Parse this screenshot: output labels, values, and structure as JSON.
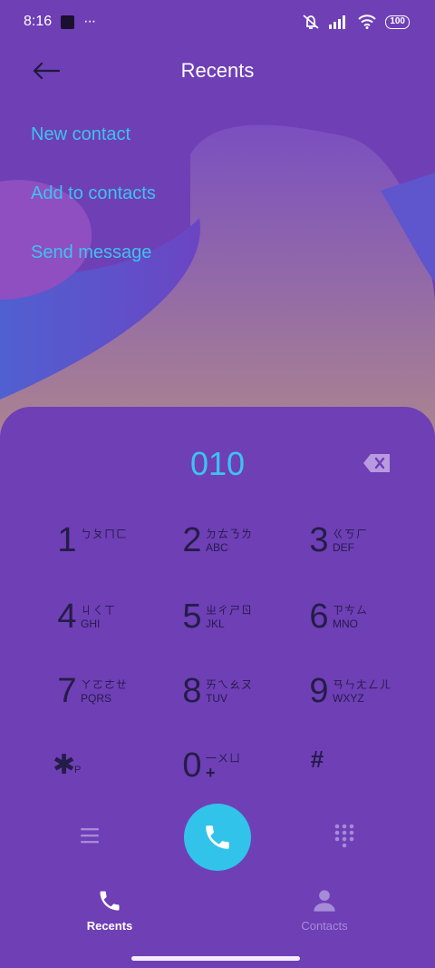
{
  "status_bar": {
    "time": "8:16",
    "dots": "···",
    "battery": "100"
  },
  "header": {
    "title": "Recents"
  },
  "menu": {
    "items": [
      "New contact",
      "Add to contacts",
      "Send message"
    ]
  },
  "dialer": {
    "number": "010",
    "keys": [
      {
        "digit": "1",
        "zhuyin": "ㄅㄆㄇㄈ",
        "letters": ""
      },
      {
        "digit": "2",
        "zhuyin": "ㄉㄊㄋㄌ",
        "letters": "ABC"
      },
      {
        "digit": "3",
        "zhuyin": "ㄍㄎㄏ",
        "letters": "DEF"
      },
      {
        "digit": "4",
        "zhuyin": "ㄐㄑㄒ",
        "letters": "GHI"
      },
      {
        "digit": "5",
        "zhuyin": "ㄓㄔㄕㄖ",
        "letters": "JKL"
      },
      {
        "digit": "6",
        "zhuyin": "ㄗㄘㄙ",
        "letters": "MNO"
      },
      {
        "digit": "7",
        "zhuyin": "ㄚㄛㄜㄝ",
        "letters": "PQRS"
      },
      {
        "digit": "8",
        "zhuyin": "ㄞㄟㄠㄡ",
        "letters": "TUV"
      },
      {
        "digit": "9",
        "zhuyin": "ㄢㄣㄤㄥㄦ",
        "letters": "WXYZ"
      },
      {
        "digit": "✱",
        "zhuyin": "",
        "letters": "P"
      },
      {
        "digit": "0",
        "zhuyin": "一ㄨㄩ",
        "letters": "+"
      },
      {
        "digit": "#",
        "zhuyin": "",
        "letters": ""
      }
    ]
  },
  "nav": {
    "recents": "Recents",
    "contacts": "Contacts"
  },
  "colors": {
    "background": "#6f3fb6",
    "accent": "#3cc3f0",
    "call_button": "#31c3ea",
    "key_text": "#241c48"
  }
}
